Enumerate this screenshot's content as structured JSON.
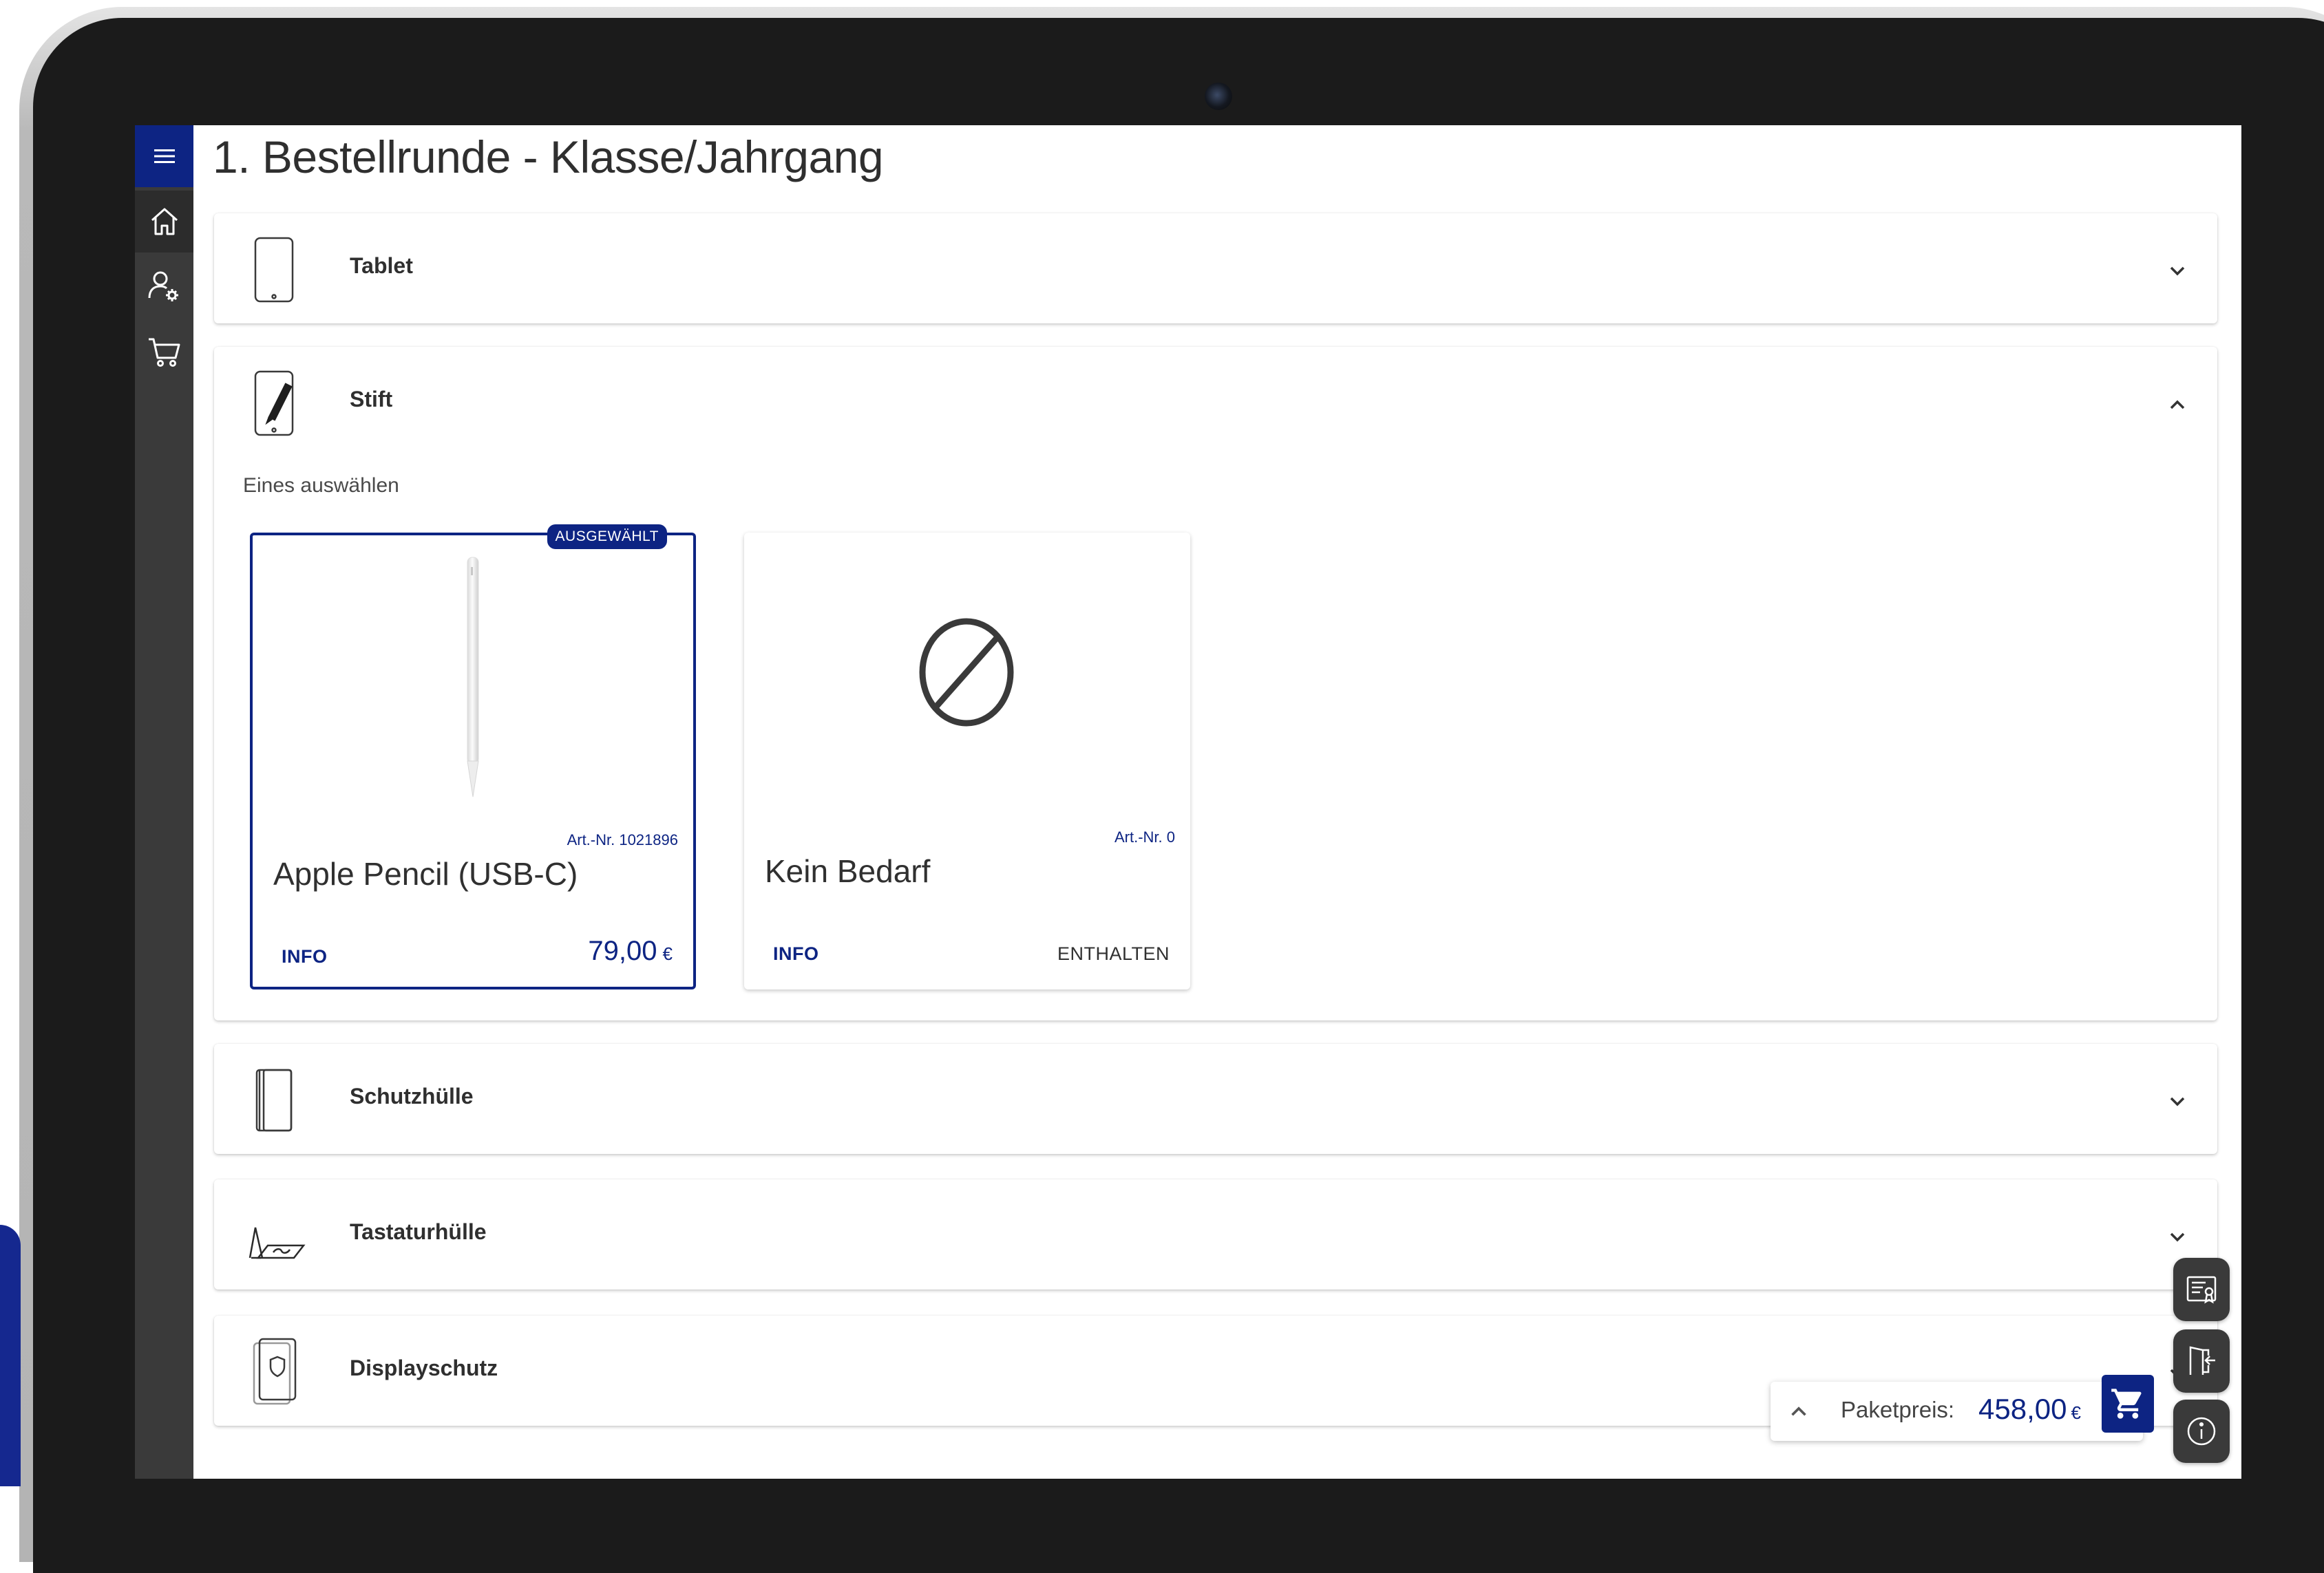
{
  "page_title": "1. Bestellrunde - Klasse/Jahrgang",
  "sidebar": {
    "items": [
      {
        "icon": "home-icon",
        "active": true
      },
      {
        "icon": "user-settings-icon",
        "active": false
      },
      {
        "icon": "cart-icon",
        "active": false
      }
    ]
  },
  "categories": [
    {
      "title": "Tablet",
      "icon": "tablet-icon",
      "expanded": false
    },
    {
      "title": "Stift",
      "icon": "pen-tablet-icon",
      "expanded": true,
      "hint": "Eines auswählen",
      "products": [
        {
          "name": "Apple Pencil (USB-C)",
          "art_no": "Art.-Nr. 1021896",
          "info_label": "INFO",
          "price": "79,00",
          "currency": "€",
          "selected": true,
          "badge": "AUSGEWÄHLT",
          "image_icon": "apple-pencil-image"
        },
        {
          "name": "Kein Bedarf",
          "art_no": "Art.-Nr. 0",
          "info_label": "INFO",
          "included_label": "ENTHALTEN",
          "selected": false,
          "image_icon": "no-entry-icon"
        }
      ]
    },
    {
      "title": "Schutzhülle",
      "icon": "case-icon",
      "expanded": false
    },
    {
      "title": "Tastaturhülle",
      "icon": "keyboard-case-icon",
      "expanded": false
    },
    {
      "title": "Displayschutz",
      "icon": "screen-protector-icon",
      "expanded": false
    }
  ],
  "summary": {
    "label": "Paketpreis:",
    "total": "458,00",
    "currency": "€"
  },
  "floating_actions": [
    "certificate-list-icon",
    "logout-door-icon",
    "info-icon"
  ],
  "colors": {
    "primary": "#0d2483",
    "sidebar": "#3a3a3a",
    "text": "#2f2f2f"
  }
}
